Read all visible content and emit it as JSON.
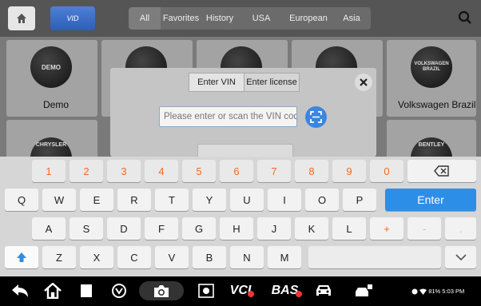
{
  "topbar": {
    "home_icon": "home-icon",
    "vid_label": "VID",
    "tabs": [
      {
        "label": "All",
        "active": true
      },
      {
        "label": "Favorites",
        "active": false
      },
      {
        "label": "History",
        "active": false
      },
      {
        "label": "USA",
        "active": false
      },
      {
        "label": "European",
        "active": false
      },
      {
        "label": "Asia",
        "active": false
      }
    ],
    "search_icon": "search-icon"
  },
  "grid": {
    "cells": [
      {
        "label": "Demo",
        "logo_text": "DEMO"
      },
      {
        "label": "Volkswagen Brazil",
        "logo_text": "VOLKSWAGEN BRAZIL"
      },
      {
        "label": "",
        "logo_text": "CHRYSLER"
      },
      {
        "label": "",
        "logo_text": "BENTLEY"
      }
    ]
  },
  "dialog": {
    "tabs": [
      {
        "label": "Enter VIN",
        "active": true
      },
      {
        "label": "Enter license",
        "active": false
      }
    ],
    "vin_placeholder": "Please enter or scan the VIN code",
    "vin_value": "",
    "close_icon": "close-icon",
    "scan_icon": "scan-icon"
  },
  "keyboard": {
    "row_numbers": [
      "1",
      "2",
      "3",
      "4",
      "5",
      "6",
      "7",
      "8",
      "9",
      "0"
    ],
    "row_q": [
      "Q",
      "W",
      "E",
      "R",
      "T",
      "Y",
      "U",
      "I",
      "O",
      "P"
    ],
    "row_a": [
      "A",
      "S",
      "D",
      "F",
      "G",
      "H",
      "J",
      "K",
      "L",
      "+",
      "-",
      "."
    ],
    "row_z": [
      "Z",
      "X",
      "C",
      "V",
      "B",
      "N",
      "M"
    ],
    "enter_label": "Enter",
    "backspace_icon": "backspace-icon",
    "shift_icon": "shift-icon",
    "hide_icon": "chevron-down-icon"
  },
  "navbar": {
    "vc_label": "VCI",
    "bas_label": "BAS",
    "status": "81% 5:03 PM"
  },
  "colors": {
    "accent_blue": "#2d8ee8",
    "number_orange": "#f26a21"
  }
}
